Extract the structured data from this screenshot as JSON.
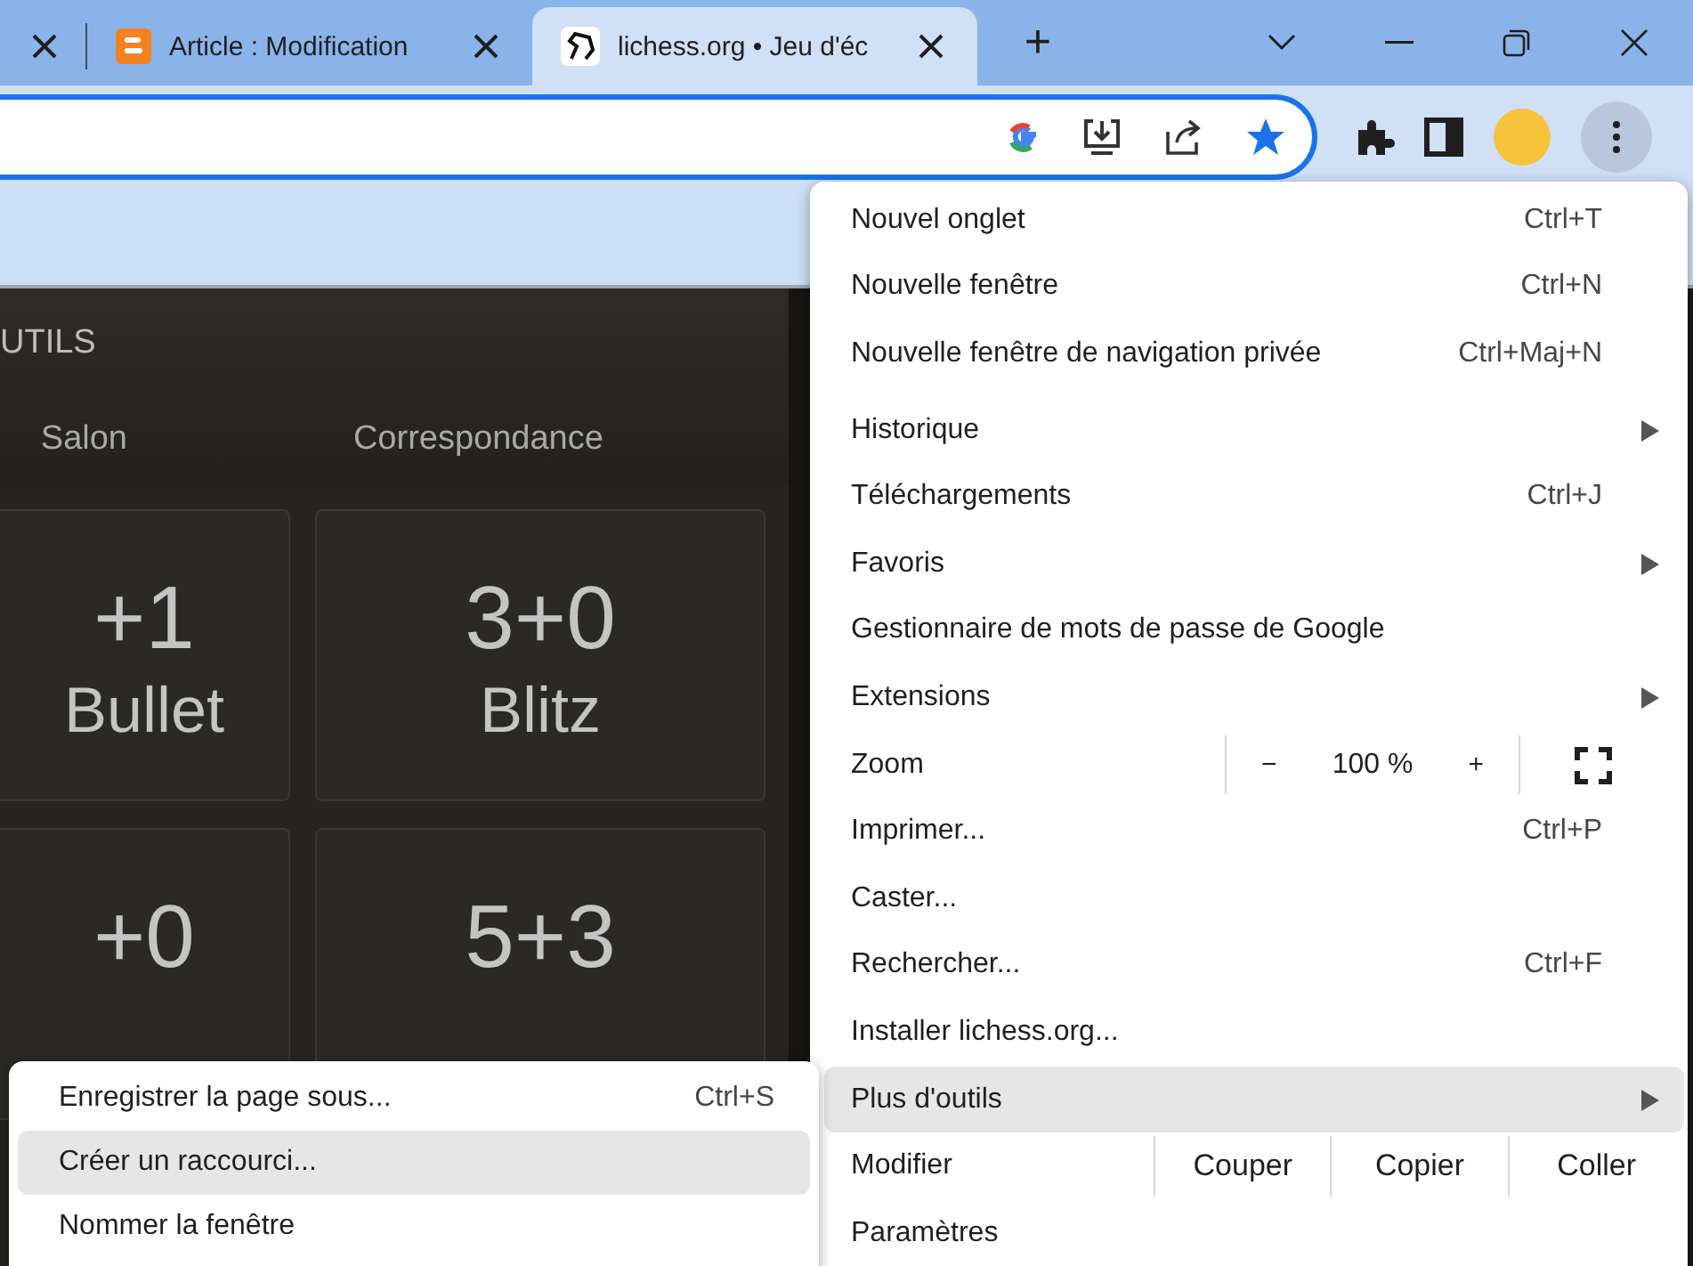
{
  "tabs": [
    {
      "label": "Article : Modification",
      "kind": "blog",
      "selected": false
    },
    {
      "label": "lichess.org • Jeu d'éc",
      "kind": "chess",
      "selected": true
    }
  ],
  "new_tab": "+",
  "page": {
    "section_title": "UTILS",
    "page_tabs": [
      "Salon",
      "Correspondance"
    ],
    "tiles": [
      {
        "time": "+1",
        "type": "Bullet"
      },
      {
        "time": "3+0",
        "type": "Blitz"
      },
      {
        "time": "+0"
      },
      {
        "time": "5+3"
      }
    ]
  },
  "menu": [
    {
      "kind": "item",
      "label": "Nouvel onglet",
      "shortcut": "Ctrl+T",
      "submenu": false,
      "selected": false
    },
    {
      "kind": "item",
      "label": "Nouvelle fenêtre",
      "shortcut": "Ctrl+N",
      "submenu": false,
      "selected": false
    },
    {
      "kind": "item",
      "label": "Nouvelle fenêtre de navigation privée",
      "shortcut": "Ctrl+Maj+N",
      "submenu": false,
      "selected": false
    },
    {
      "kind": "item",
      "label": "Historique",
      "submenu": true,
      "selected": false
    },
    {
      "kind": "item",
      "label": "Téléchargements",
      "shortcut": "Ctrl+J",
      "submenu": false,
      "selected": false
    },
    {
      "kind": "item",
      "label": "Favoris",
      "submenu": true,
      "selected": false
    },
    {
      "kind": "item",
      "label": "Gestionnaire de mots de passe de Google",
      "submenu": false,
      "selected": false
    },
    {
      "kind": "item",
      "label": "Extensions",
      "submenu": true,
      "selected": false
    },
    {
      "kind": "zoom",
      "label": "Zoom",
      "minus": "−",
      "value": "100 %",
      "plus": "+"
    },
    {
      "kind": "item",
      "label": "Imprimer...",
      "shortcut": "Ctrl+P",
      "submenu": false,
      "selected": false
    },
    {
      "kind": "item",
      "label": "Caster...",
      "submenu": false,
      "selected": false
    },
    {
      "kind": "item",
      "label": "Rechercher...",
      "shortcut": "Ctrl+F",
      "submenu": false,
      "selected": false
    },
    {
      "kind": "item",
      "label": "Installer lichess.org...",
      "submenu": false,
      "selected": false
    },
    {
      "kind": "item",
      "label": "Plus d'outils",
      "submenu": true,
      "selected": true
    },
    {
      "kind": "edit",
      "label": "Modifier",
      "buttons": [
        "Couper",
        "Copier",
        "Coller"
      ]
    },
    {
      "kind": "item",
      "label": "Paramètres",
      "submenu": false,
      "selected": false
    }
  ],
  "submenu": [
    {
      "label": "Enregistrer la page sous...",
      "shortcut": "Ctrl+S",
      "selected": false
    },
    {
      "label": "Créer un raccourci...",
      "selected": true
    },
    {
      "label": "Nommer la fenêtre",
      "selected": false
    }
  ]
}
